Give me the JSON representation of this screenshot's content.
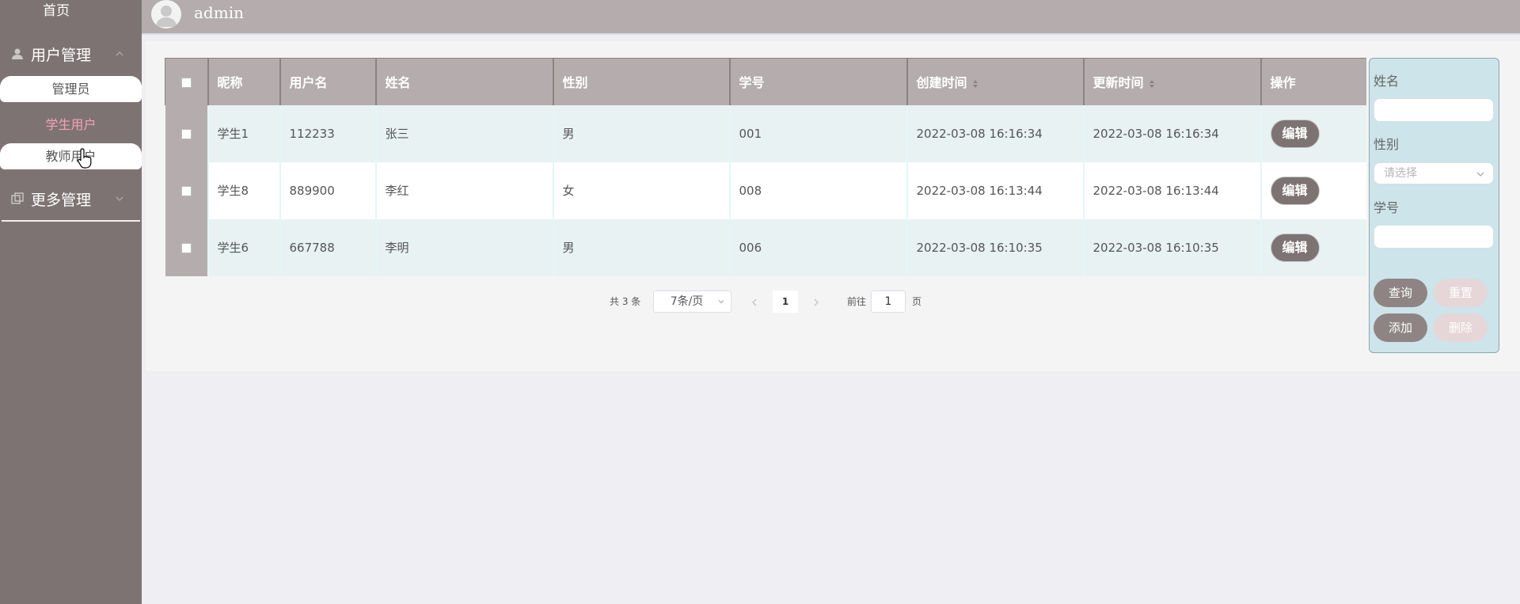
{
  "sidebar": {
    "home": "首页",
    "groups": [
      {
        "label": "用户管理"
      },
      {
        "label": "更多管理"
      }
    ],
    "items": [
      {
        "label": "管理员"
      },
      {
        "label": "学生用户"
      },
      {
        "label": "教师用户"
      }
    ]
  },
  "header": {
    "username": "admin"
  },
  "table": {
    "columns": [
      "昵称",
      "用户名",
      "姓名",
      "性别",
      "学号",
      "创建时间",
      "更新时间",
      "操作"
    ],
    "rows": [
      {
        "nickname": "学生1",
        "username": "112233",
        "name": "张三",
        "gender": "男",
        "student_no": "001",
        "created": "2022-03-08 16:16:34",
        "updated": "2022-03-08 16:16:34",
        "action": "编辑"
      },
      {
        "nickname": "学生8",
        "username": "889900",
        "name": "李红",
        "gender": "女",
        "student_no": "008",
        "created": "2022-03-08 16:13:44",
        "updated": "2022-03-08 16:13:44",
        "action": "编辑"
      },
      {
        "nickname": "学生6",
        "username": "667788",
        "name": "李明",
        "gender": "男",
        "student_no": "006",
        "created": "2022-03-08 16:10:35",
        "updated": "2022-03-08 16:10:35",
        "action": "编辑"
      }
    ]
  },
  "pagination": {
    "total_text": "共 3 条",
    "page_size": "7条/页",
    "current_page": "1",
    "goto_label": "前往",
    "goto_value": "1",
    "page_suffix": "页"
  },
  "search": {
    "name_label": "姓名",
    "gender_label": "性别",
    "gender_placeholder": "请选择",
    "student_no_label": "学号",
    "buttons": {
      "query": "查询",
      "reset": "重置",
      "add": "添加",
      "delete": "删除"
    }
  },
  "colors": {
    "sidebar": "#7e7373",
    "header": "#b5adad",
    "accent_pink": "#f5a3b2",
    "row_alt": "#e8f2f3",
    "search_panel": "#cce4ea"
  }
}
